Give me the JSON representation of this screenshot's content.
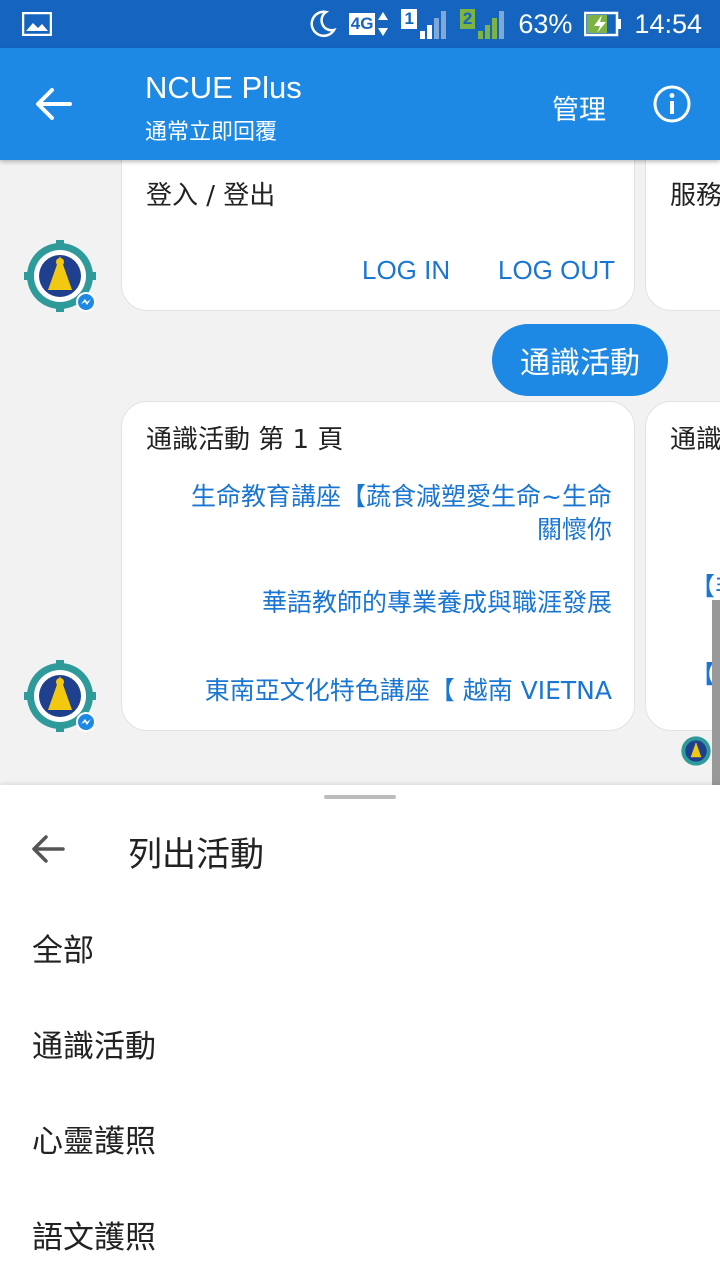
{
  "status_bar": {
    "network": "4G",
    "sim1": "1",
    "sim2": "2",
    "battery": "63%",
    "time": "14:54"
  },
  "app_bar": {
    "title": "NCUE Plus",
    "subtitle": "通常立即回覆",
    "manage_label": "管理"
  },
  "chat": {
    "card1": {
      "title": "登入 / 登出",
      "buttons": [
        "LOG IN",
        "LOG OUT"
      ]
    },
    "card1_peek_title": "服務",
    "user_message": "通識活動",
    "card2": {
      "title": "通識活動 第 1 頁",
      "links": [
        "生命教育講座【蔬食減塑愛生命~生命",
        "關懷你",
        "華語教師的專業養成與職涯發展",
        "東南亞文化特色講座【 越南 VIETNA"
      ]
    },
    "card2_peek": {
      "title": "通識",
      "line1": "【非",
      "line2": "【公"
    }
  },
  "sheet": {
    "title": "列出活動",
    "items": [
      "全部",
      "通識活動",
      "心靈護照",
      "語文護照"
    ]
  },
  "colors": {
    "status_bar": "#1565c0",
    "app_bar": "#1e88e5",
    "link": "#1976d2",
    "user_bubble": "#1e88e5"
  }
}
